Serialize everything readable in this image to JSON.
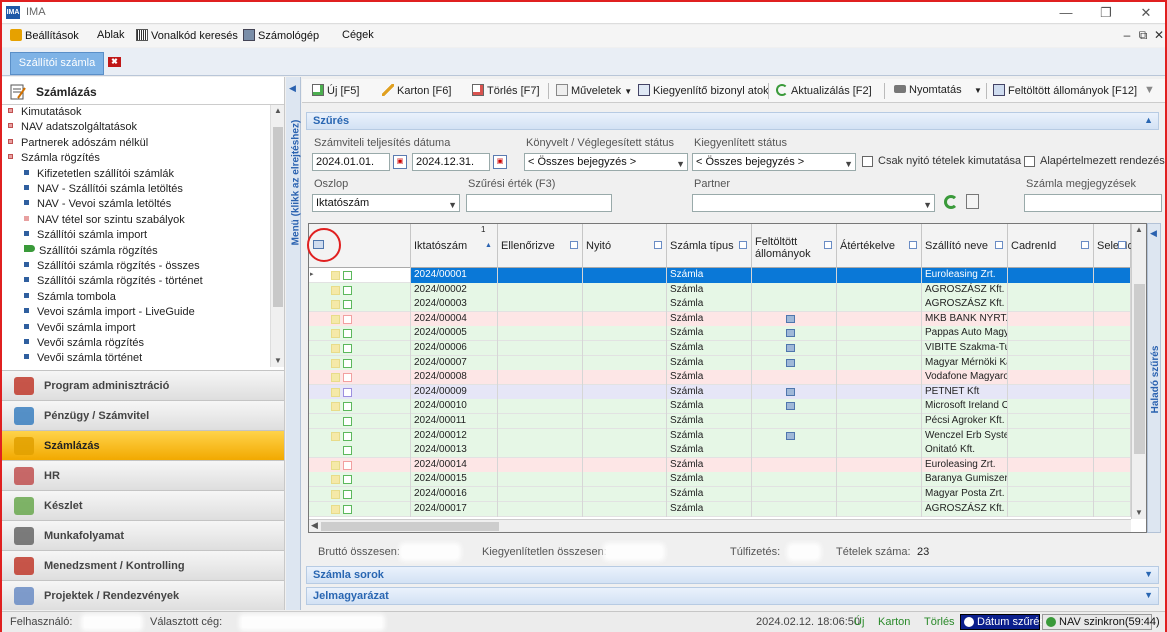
{
  "window": {
    "title": "IMA",
    "app_icon": "IMA"
  },
  "menubar": {
    "items": [
      "Beállítások",
      "Ablak",
      "Vonalkód keresés",
      "Számológép",
      "Cégek"
    ]
  },
  "tabs": {
    "active": "Szállítói számla"
  },
  "sidebar": {
    "header": "Számlázás",
    "tree": [
      {
        "label": "Kimutatások",
        "level": 0
      },
      {
        "label": "NAV adatszolgáltatások",
        "level": 0
      },
      {
        "label": "Partnerek adószám nélkül",
        "level": 0
      },
      {
        "label": "Számla rögzítés",
        "level": 0
      },
      {
        "label": "Kifizetetlen szállítói számlák",
        "level": 1
      },
      {
        "label": "NAV - Szállítói számla letöltés",
        "level": 1
      },
      {
        "label": "NAV - Vevoi számla letöltés",
        "level": 1
      },
      {
        "label": "NAV tétel sor szintu szabályok",
        "level": 1
      },
      {
        "label": "Szállítói számla import",
        "level": 1
      },
      {
        "label": "Szállítói számla rögzítés",
        "level": 1,
        "active": true
      },
      {
        "label": "Szállítói számla rögzítés - összes",
        "level": 1
      },
      {
        "label": "Szállítói számla rögzítés - történet",
        "level": 1
      },
      {
        "label": "Számla tombola",
        "level": 1
      },
      {
        "label": "Vevoi számla import - LiveGuide",
        "level": 1
      },
      {
        "label": "Vevői számla import",
        "level": 1
      },
      {
        "label": "Vevői számla rögzítés",
        "level": 1
      },
      {
        "label": "Vevői számla történet",
        "level": 1
      }
    ],
    "modules": [
      {
        "label": "Program adminisztráció",
        "icon": "home-icon"
      },
      {
        "label": "Pénzügy / Számvitel",
        "icon": "calculator-icon"
      },
      {
        "label": "Számlázás",
        "icon": "invoice-icon",
        "active": true
      },
      {
        "label": "HR",
        "icon": "people-icon"
      },
      {
        "label": "Készlet",
        "icon": "box-icon"
      },
      {
        "label": "Munkafolyamat",
        "icon": "workflow-icon"
      },
      {
        "label": "Menedzsment / Kontrolling",
        "icon": "chart-icon"
      },
      {
        "label": "Projektek / Rendezvények",
        "icon": "project-icon"
      }
    ],
    "rail_label": "Menü (klikk az elrejtéshez)"
  },
  "toolbar": {
    "new": "Új [F5]",
    "karton": "Karton [F6]",
    "delete": "Törlés [F7]",
    "actions": "Műveletek",
    "settle": "Kiegyenlítő bizonyl atok",
    "refresh": "Aktualizálás [F2]",
    "print": "Nyomtatás",
    "uploaded": "Feltöltött állományok [F12]"
  },
  "filter": {
    "section": "Szűrés",
    "date_label": "Számviteli teljesítés dátuma",
    "date_from": "2024.01.01.",
    "date_to": "2024.12.31.",
    "booked_label": "Könyvelt / Véglegesített státus",
    "booked_value": "< Összes bejegyzés >",
    "settled_label": "Kiegyenlített státus",
    "settled_value": "< Összes bejegyzés >",
    "only_open": "Csak nyitó tételek kimutatása",
    "default_sort": "Alapértelmezett rendezés",
    "column_label": "Oszlop",
    "column_value": "Iktatószám",
    "filter_value_label": "Szűrési érték (F3)",
    "filter_value": "",
    "partner_label": "Partner",
    "partner_value": "",
    "note_label": "Számla megjegyzések",
    "note_value": ""
  },
  "grid": {
    "sort_index": "1",
    "columns": [
      "Iktatószám",
      "Ellenőrizve",
      "Nyitó",
      "Számla típus",
      "Feltöltött állományok",
      "Átértékelve",
      "Szállító neve",
      "CadrenId",
      "SelexId"
    ],
    "rows": [
      {
        "id": "2024/00001",
        "type": "Számla",
        "supplier": "Euroleasing Zrt.",
        "file": false,
        "color": "#ffffff",
        "selected": true,
        "sq": [
          "#e8dc8a",
          "#5cb85c"
        ]
      },
      {
        "id": "2024/00002",
        "type": "Számla",
        "supplier": "AGROSZÁSZ Kft.",
        "file": false,
        "color": "#e6f7e6",
        "sq": [
          "#e8dc8a",
          "#5cb85c"
        ]
      },
      {
        "id": "2024/00003",
        "type": "Számla",
        "supplier": "AGROSZÁSZ Kft.",
        "file": false,
        "color": "#e6f7e6",
        "sq": [
          "#e8dc8a",
          "#5cb85c"
        ]
      },
      {
        "id": "2024/00004",
        "type": "Számla",
        "supplier": "MKB BANK NYRT.",
        "file": true,
        "color": "#fde6e6",
        "sq": [
          "#e8dc8a",
          "#f2a0a0"
        ]
      },
      {
        "id": "2024/00005",
        "type": "Számla",
        "supplier": "Pappas Auto Magyar",
        "file": true,
        "color": "#e6f7e6",
        "sq": [
          "#e8dc8a",
          "#5cb85c"
        ]
      },
      {
        "id": "2024/00006",
        "type": "Számla",
        "supplier": "VIBITE Szakma-Tuda",
        "file": true,
        "color": "#e6f7e6",
        "sq": [
          "#e8dc8a",
          "#5cb85c"
        ]
      },
      {
        "id": "2024/00007",
        "type": "Számla",
        "supplier": "Magyar Mérnöki Kan",
        "file": true,
        "color": "#e6f7e6",
        "sq": [
          "#e8dc8a",
          "#5cb85c"
        ]
      },
      {
        "id": "2024/00008",
        "type": "Számla",
        "supplier": "Vodafone Magyaror",
        "file": false,
        "color": "#fde6e6",
        "sq": [
          "#e8dc8a",
          "#f2a0a0"
        ]
      },
      {
        "id": "2024/00009",
        "type": "Számla",
        "supplier": "PETNET Kft",
        "file": true,
        "color": "#e6e6f7",
        "sq": [
          "#e8dc8a",
          "#9c8fe0"
        ]
      },
      {
        "id": "2024/00010",
        "type": "Számla",
        "supplier": "Microsoft Ireland O",
        "file": true,
        "color": "#e6f7e6",
        "sq": [
          "#e8dc8a",
          "#5cb85c"
        ]
      },
      {
        "id": "2024/00011",
        "type": "Számla",
        "supplier": "Pécsi Agroker Kft. -",
        "file": false,
        "color": "#e6f7e6",
        "sq": [
          "",
          "#5cb85c"
        ]
      },
      {
        "id": "2024/00012",
        "type": "Számla",
        "supplier": "Wenczel Erb System",
        "file": true,
        "color": "#e6f7e6",
        "sq": [
          "#e8dc8a",
          "#5cb85c"
        ]
      },
      {
        "id": "2024/00013",
        "type": "Számla",
        "supplier": "Onitató Kft.",
        "file": false,
        "color": "#e6f7e6",
        "sq": [
          "",
          "#5cb85c"
        ]
      },
      {
        "id": "2024/00014",
        "type": "Számla",
        "supplier": "Euroleasing Zrt.",
        "file": false,
        "color": "#fde6e6",
        "sq": [
          "#e8dc8a",
          "#f2a0a0"
        ]
      },
      {
        "id": "2024/00015",
        "type": "Számla",
        "supplier": "Baranya Gumiszervi",
        "file": false,
        "color": "#e6f7e6",
        "sq": [
          "#e8dc8a",
          "#5cb85c"
        ]
      },
      {
        "id": "2024/00016",
        "type": "Számla",
        "supplier": "Magyar Posta Zrt.",
        "file": false,
        "color": "#e6f7e6",
        "sq": [
          "#e8dc8a",
          "#5cb85c"
        ]
      },
      {
        "id": "2024/00017",
        "type": "Számla",
        "supplier": "AGROSZÁSZ Kft.",
        "file": false,
        "color": "#e6f7e6",
        "sq": [
          "#e8dc8a",
          "#5cb85c"
        ]
      }
    ]
  },
  "advanced_rail": "Haladó szűrés",
  "summary": {
    "gross_label": "Bruttó összesen:",
    "unsettled_label": "Kiegyenlítetlen összesen:",
    "overpay_label": "Túlfizetés:",
    "count_label": "Tételek száma:",
    "count_value": "23"
  },
  "panels": {
    "invoice_rows": "Számla sorok",
    "legend": "Jelmagyarázat"
  },
  "statusbar": {
    "user_label": "Felhasználó:",
    "company_label": "Választott cég:",
    "datetime": "2024.02.12. 18:06:50",
    "new": "Új",
    "karton": "Karton",
    "delete": "Törlés",
    "date_filter": "Dátum szűrés",
    "nav_sync": "NAV szinkron(59:44)"
  },
  "colors": {
    "accent": "#2966b2",
    "active_module": "#f2a900",
    "selection": "#0a78d7",
    "highlight": "#e02020"
  }
}
